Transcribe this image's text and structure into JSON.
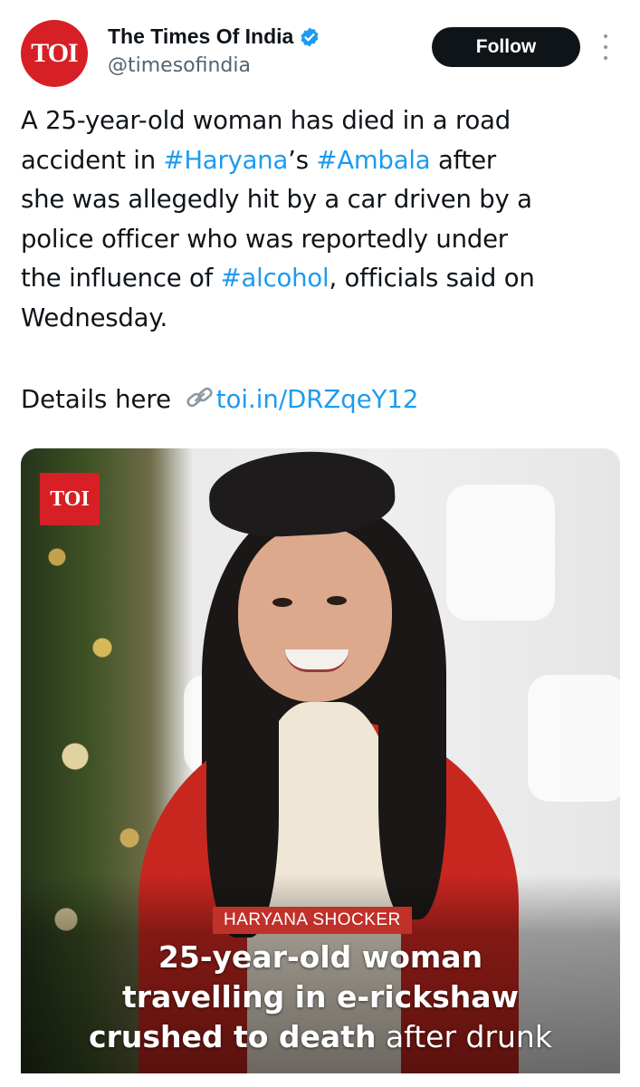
{
  "account": {
    "display_name": "The Times Of India",
    "handle": "@timesofindia",
    "avatar_text": "TOI",
    "verified": true
  },
  "actions": {
    "follow_label": "Follow",
    "more_icon": "more-vertical-icon"
  },
  "tweet": {
    "lines": [
      {
        "parts": [
          {
            "t": "A 25-year-old woman has died in a road",
            "tag": false
          }
        ]
      },
      {
        "parts": [
          {
            "t": "accident in ",
            "tag": false
          },
          {
            "t": "#Haryana",
            "tag": true
          },
          {
            "t": "’s ",
            "tag": false
          },
          {
            "t": "#Ambala",
            "tag": true
          },
          {
            "t": " after",
            "tag": false
          }
        ]
      },
      {
        "parts": [
          {
            "t": "she was allegedly hit by a car driven by a",
            "tag": false
          }
        ]
      },
      {
        "parts": [
          {
            "t": "police officer who was reportedly under",
            "tag": false
          }
        ]
      },
      {
        "parts": [
          {
            "t": "the influence of ",
            "tag": false
          },
          {
            "t": "#alcohol",
            "tag": true
          },
          {
            "t": ", officials said on",
            "tag": false
          }
        ]
      },
      {
        "parts": [
          {
            "t": "Wednesday.",
            "tag": false
          }
        ]
      }
    ],
    "details_prefix": "Details here ",
    "link_icon": "link-icon",
    "link_text": "toi.in/DRZqeY12"
  },
  "media": {
    "badge_text": "TOI",
    "kicker": "HARYANA SHOCKER",
    "headline_line1": "25-year-old woman",
    "headline_line2": "travelling in e-rickshaw",
    "headline_line3_bold": "crushed to death",
    "headline_line3_rest": " after drunk"
  },
  "colors": {
    "accent": "#1d9bf0",
    "brand": "#d71f26",
    "follow_bg": "#0f1419"
  }
}
